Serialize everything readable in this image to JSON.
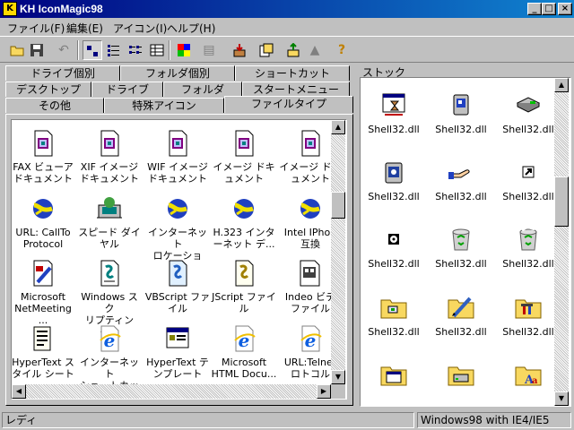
{
  "window": {
    "title": "KH IconMagic98",
    "minimize": "_",
    "maximize": "□",
    "close": "×"
  },
  "menu": [
    "ファイル(F)",
    "編集(E)",
    "アイコン(I)",
    "ヘルプ(H)"
  ],
  "toolbar": {
    "icons": [
      "open-folder-icon",
      "save-disk-icon",
      "undo-icon",
      "large-icon-view-icon",
      "small-icon-view-icon",
      "list-view-icon",
      "details-view-icon",
      "color-palette-icon",
      "print-icon",
      "extract-icon",
      "copy-icon",
      "export-icon",
      "import-icon",
      "help-icon"
    ],
    "help_glyph": "?"
  },
  "tabs": {
    "row1": [
      "ドライブ個別",
      "フォルダ個別",
      "ショートカット"
    ],
    "row2": [
      "デスクトップ",
      "ドライブ",
      "フォルダ",
      "スタートメニュー"
    ],
    "row3": [
      "その他",
      "特殊アイコン",
      "ファイルタイプ"
    ],
    "active": "ファイルタイプ"
  },
  "file_types": [
    {
      "label": "FAX ビューア\nドキュメント",
      "icon": "fax-document-icon"
    },
    {
      "label": "XIF イメージ\nドキュメント",
      "icon": "image-document-icon"
    },
    {
      "label": "WIF イメージ\nドキュメント",
      "icon": "image-document-icon"
    },
    {
      "label": "イメージ ドキ\nュメント",
      "icon": "image-document-icon"
    },
    {
      "label": "イメージ ドキ\nュメント",
      "icon": "image-document-icon"
    },
    {
      "label": "URL: CallTo\nProtocol",
      "icon": "url-protocol-icon"
    },
    {
      "label": "スピード ダイ\nヤル",
      "icon": "speed-dial-icon"
    },
    {
      "label": "インターネット\nロケーション...",
      "icon": "url-protocol-icon"
    },
    {
      "label": "H.323 インタ\nーネット デ...",
      "icon": "url-protocol-icon"
    },
    {
      "label": "Intel IPhon\n互換",
      "icon": "url-protocol-icon"
    },
    {
      "label": "Microsoft\nNetMeeting ...",
      "icon": "netmeeting-icon"
    },
    {
      "label": "Windows スク\nリプティング...",
      "icon": "script-icon"
    },
    {
      "label": "VBScript ファ\nイル",
      "icon": "vbscript-icon"
    },
    {
      "label": "JScript ファイ\nル",
      "icon": "jscript-icon"
    },
    {
      "label": "Indeo ビデ\nファイル",
      "icon": "video-file-icon"
    },
    {
      "label": "HyperText ス\nタイル シート",
      "icon": "style-sheet-icon"
    },
    {
      "label": "インターネット\nショートカット",
      "icon": "ie-icon"
    },
    {
      "label": "HyperText テ\nンプレート",
      "icon": "template-icon"
    },
    {
      "label": "Microsoft\nHTML Docu...",
      "icon": "ie-icon"
    },
    {
      "label": "URL:Telnet\nロトコル",
      "icon": "ie-icon"
    }
  ],
  "stock": {
    "label": "ストック",
    "items": [
      {
        "label": "Shell32.dll",
        "icon": "hourglass-window-icon"
      },
      {
        "label": "Shell32.dll",
        "icon": "disk-drive-icon"
      },
      {
        "label": "Shell32.dll",
        "icon": "network-drive-icon"
      },
      {
        "label": "Shell32.dll",
        "icon": "cdrom-drive-icon"
      },
      {
        "label": "Shell32.dll",
        "icon": "sharing-hand-icon"
      },
      {
        "label": "Shell32.dll",
        "icon": "shortcut-arrow-icon"
      },
      {
        "label": "Shell32.dll",
        "icon": "small-disk-icon"
      },
      {
        "label": "Shell32.dll",
        "icon": "recycle-bin-empty-icon"
      },
      {
        "label": "Shell32.dll",
        "icon": "recycle-bin-full-icon"
      },
      {
        "label": "Shell32.dll",
        "icon": "control-panel-folder-icon"
      },
      {
        "label": "Shell32.dll",
        "icon": "write-folder-icon"
      },
      {
        "label": "Shell32.dll",
        "icon": "tools-folder-icon"
      },
      {
        "label": "",
        "icon": "calendar-folder-icon"
      },
      {
        "label": "",
        "icon": "hard-disk-folder-icon"
      },
      {
        "label": "",
        "icon": "fonts-folder-icon"
      }
    ]
  },
  "status": {
    "left": "レディ",
    "right": "Windows98 with IE4/IE5"
  },
  "colors": {
    "title_start": "#000080",
    "title_end": "#1084d0",
    "face": "#c0c0c0",
    "folder_yellow": "#f8d860"
  }
}
